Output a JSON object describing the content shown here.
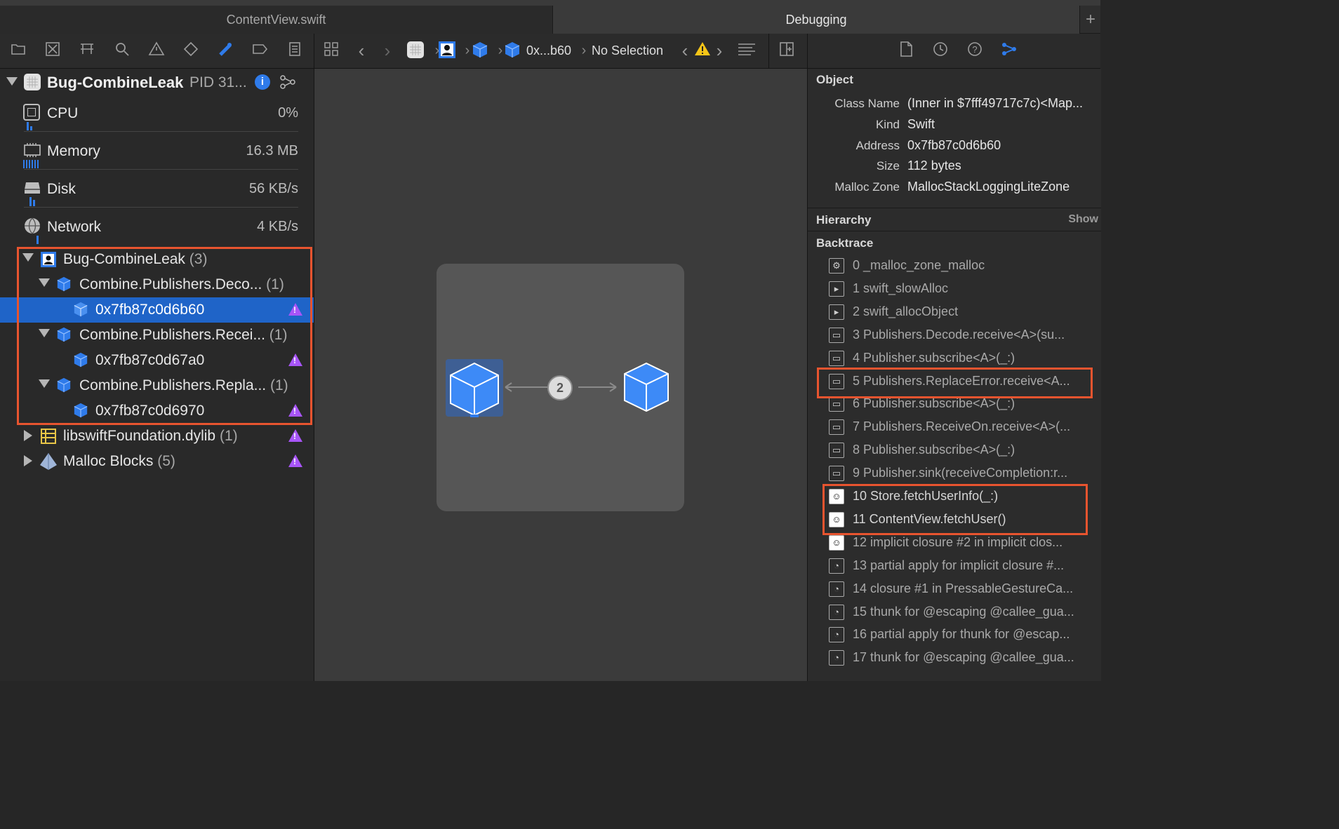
{
  "tabs": {
    "file_tab": "ContentView.swift",
    "debug_tab": "Debugging",
    "add": "+"
  },
  "jump_bar": {
    "address": "0x...b60",
    "selection": "No Selection"
  },
  "process": {
    "name": "Bug-CombineLeak",
    "pid": "PID 31..."
  },
  "gauges": [
    {
      "label": "CPU",
      "value": "0%"
    },
    {
      "label": "Memory",
      "value": "16.3 MB"
    },
    {
      "label": "Disk",
      "value": "56 KB/s"
    },
    {
      "label": "Network",
      "value": "4 KB/s"
    }
  ],
  "tree": {
    "group": {
      "label": "Bug-CombineLeak",
      "count": "(3)"
    },
    "items": [
      {
        "label": "Combine.Publishers.Deco...",
        "count": "(1)"
      },
      {
        "label": "0x7fb87c0d6b60"
      },
      {
        "label": "Combine.Publishers.Recei...",
        "count": "(1)"
      },
      {
        "label": "0x7fb87c0d67a0"
      },
      {
        "label": "Combine.Publishers.Repla...",
        "count": "(1)"
      },
      {
        "label": "0x7fb87c0d6970"
      }
    ],
    "lib": {
      "label": "libswiftFoundation.dylib",
      "count": "(1)"
    },
    "malloc": {
      "label": "Malloc Blocks",
      "count": "(5)"
    }
  },
  "graph": {
    "edge_count": "2"
  },
  "inspector": {
    "object_title": "Object",
    "fields": [
      {
        "key": "Class Name",
        "value": "(Inner in $7fff49717c7c)<Map..."
      },
      {
        "key": "Kind",
        "value": "Swift"
      },
      {
        "key": "Address",
        "value": "0x7fb87c0d6b60"
      },
      {
        "key": "Size",
        "value": "112 bytes"
      },
      {
        "key": "Malloc Zone",
        "value": "MallocStackLoggingLiteZone"
      }
    ],
    "hierarchy_title": "Hierarchy",
    "hierarchy_action": "Show",
    "backtrace_title": "Backtrace",
    "backtrace": [
      {
        "text": "0 _malloc_zone_malloc",
        "icon": "gear-icon"
      },
      {
        "text": "1 swift_slowAlloc",
        "icon": "terminal-icon"
      },
      {
        "text": "2 swift_allocObject",
        "icon": "terminal-icon"
      },
      {
        "text": "3 Publishers.Decode.receive<A>(su...",
        "icon": "briefcase-icon"
      },
      {
        "text": "4 Publisher.subscribe<A>(_:)",
        "icon": "briefcase-icon"
      },
      {
        "text": "5 Publishers.ReplaceError.receive<A...",
        "icon": "briefcase-icon"
      },
      {
        "text": "6 Publisher.subscribe<A>(_:)",
        "icon": "briefcase-icon"
      },
      {
        "text": "7 Publishers.ReceiveOn.receive<A>(...",
        "icon": "briefcase-icon"
      },
      {
        "text": "8 Publisher.subscribe<A>(_:)",
        "icon": "briefcase-icon"
      },
      {
        "text": "9 Publisher.sink(receiveCompletion:r...",
        "icon": "briefcase-icon"
      },
      {
        "text": "10 Store.fetchUserInfo(_:)",
        "icon": "user-icon"
      },
      {
        "text": "11 ContentView.fetchUser()",
        "icon": "user-icon"
      },
      {
        "text": "12 implicit closure #2 in implicit clos...",
        "icon": "user-icon"
      },
      {
        "text": "13 partial apply for implicit closure #...",
        "icon": "swift-icon"
      },
      {
        "text": "14 closure #1 in PressableGestureCa...",
        "icon": "swift-icon"
      },
      {
        "text": "15 thunk for @escaping @callee_gua...",
        "icon": "swift-icon"
      },
      {
        "text": "16 partial apply for thunk for @escap...",
        "icon": "swift-icon"
      },
      {
        "text": "17 thunk for @escaping @callee_gua...",
        "icon": "swift-icon"
      }
    ]
  },
  "colors": {
    "accent": "#2f7bea",
    "selection": "#1f64c8",
    "highlight_box": "#e8542f",
    "warning": "#a855f7"
  }
}
